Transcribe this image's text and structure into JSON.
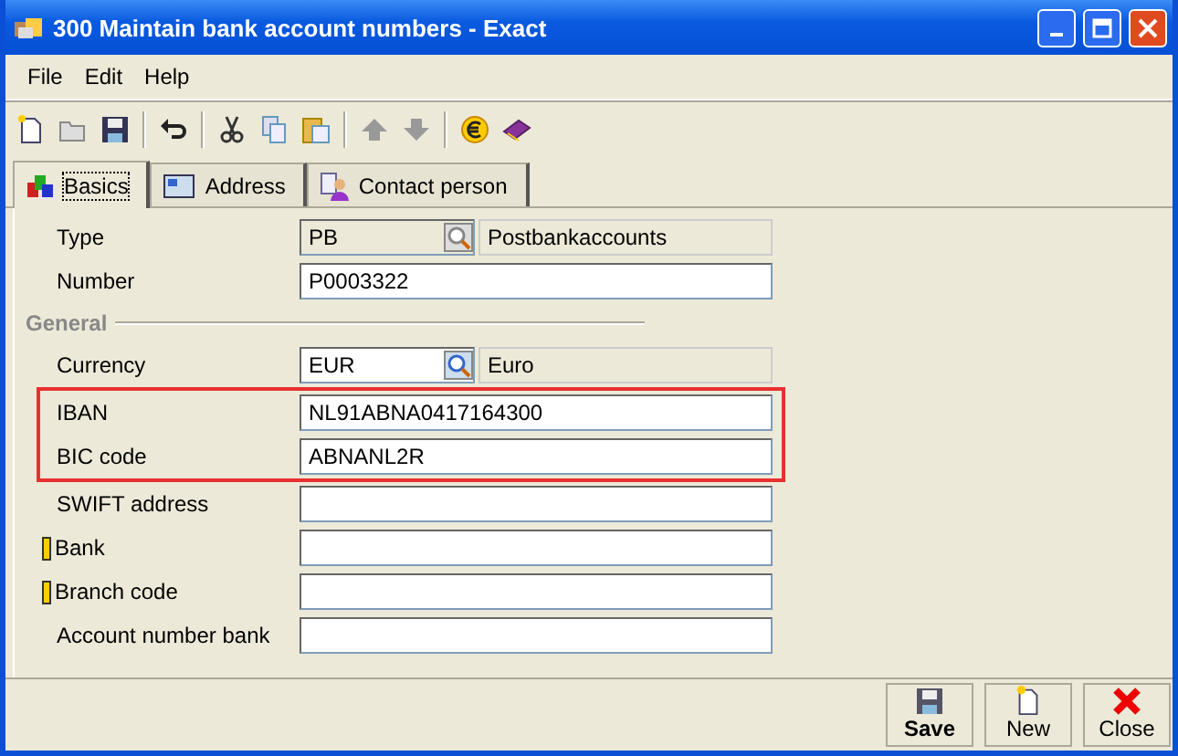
{
  "window": {
    "title": "300 Maintain bank account numbers - Exact"
  },
  "menu": [
    {
      "label": "File"
    },
    {
      "label": "Edit"
    },
    {
      "label": "Help"
    }
  ],
  "tabs": [
    {
      "label": "Basics",
      "selected": true
    },
    {
      "label": "Address",
      "selected": false
    },
    {
      "label": "Contact person",
      "selected": false
    }
  ],
  "form": [
    {
      "kind": "lookup",
      "label": "Type",
      "value": "PB",
      "description": "Postbankaccounts",
      "required": false,
      "highlighted": false
    },
    {
      "kind": "text",
      "label": "Number",
      "value": "P0003322",
      "required": false,
      "highlighted": false
    },
    {
      "kind": "section",
      "label": "General"
    },
    {
      "kind": "lookup",
      "label": "Currency",
      "value": "EUR",
      "description": "Euro",
      "required": false,
      "highlighted": false,
      "editable": true
    },
    {
      "kind": "text",
      "label": "IBAN",
      "value": "NL91ABNA0417164300",
      "required": false,
      "highlighted": true
    },
    {
      "kind": "text",
      "label": "BIC code",
      "value": "ABNANL2R",
      "required": false,
      "highlighted": true
    },
    {
      "kind": "text",
      "label": "SWIFT address",
      "required": false,
      "highlighted": false
    },
    {
      "kind": "text",
      "label": "Bank",
      "required": true,
      "highlighted": false
    },
    {
      "kind": "text",
      "label": "Branch code",
      "required": true,
      "highlighted": false
    },
    {
      "kind": "text",
      "label": "Account number bank",
      "required": false,
      "highlighted": false
    }
  ],
  "buttons": [
    {
      "label": "Save",
      "kind": "save",
      "default": true
    },
    {
      "label": "New",
      "kind": "new",
      "default": false
    },
    {
      "label": "Close",
      "kind": "close",
      "default": false
    }
  ]
}
